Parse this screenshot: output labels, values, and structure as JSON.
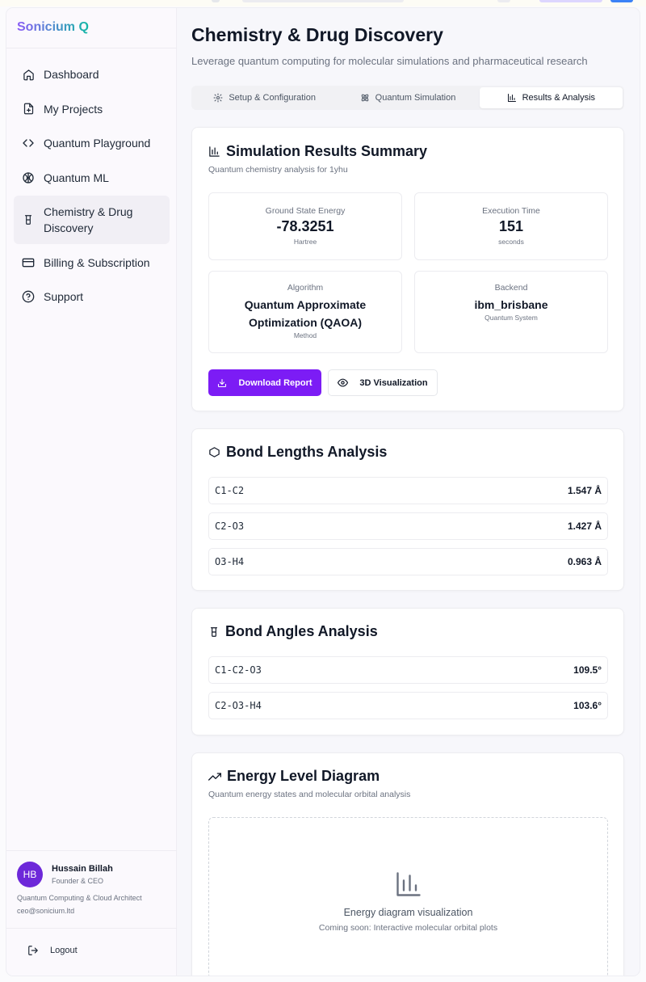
{
  "brand": "Sonicium Q",
  "sidebar": {
    "items": [
      {
        "label": "Dashboard",
        "icon": "home-icon"
      },
      {
        "label": "My Projects",
        "icon": "file-plus-icon"
      },
      {
        "label": "Quantum Playground",
        "icon": "code-icon"
      },
      {
        "label": "Quantum ML",
        "icon": "brain-icon"
      },
      {
        "label": "Chemistry & Drug Discovery",
        "icon": "beaker-icon",
        "active": true
      },
      {
        "label": "Billing & Subscription",
        "icon": "credit-card-icon"
      },
      {
        "label": "Support",
        "icon": "help-circle-icon"
      }
    ]
  },
  "profile": {
    "initials": "HB",
    "name": "Hussain Billah",
    "role": "Founder & CEO",
    "title": "Quantum Computing & Cloud Architect",
    "email": "ceo@sonicium.ltd"
  },
  "logout_label": "Logout",
  "page": {
    "title": "Chemistry & Drug Discovery",
    "subtitle": "Leverage quantum computing for molecular simulations and pharmaceutical research"
  },
  "tabs": [
    {
      "label": "Setup & Configuration",
      "icon": "settings-icon"
    },
    {
      "label": "Quantum Simulation",
      "icon": "atom-icon"
    },
    {
      "label": "Results & Analysis",
      "icon": "bar-chart-icon",
      "active": true
    }
  ],
  "summary": {
    "title": "Simulation Results Summary",
    "subtitle": "Quantum chemistry analysis for 1yhu",
    "energy": {
      "label": "Ground State Energy",
      "value": "-78.3251",
      "unit": "Hartree"
    },
    "time": {
      "label": "Execution Time",
      "value": "151",
      "unit": "seconds"
    },
    "algorithm": {
      "label": "Algorithm",
      "value": "Quantum Approximate Optimization (QAOA)",
      "unit": "Method"
    },
    "backend": {
      "label": "Backend",
      "value": "ibm_brisbane",
      "unit": "Quantum System"
    },
    "download_label": "Download Report",
    "visualize_label": "3D Visualization"
  },
  "bond_lengths": {
    "title": "Bond Lengths Analysis",
    "rows": [
      {
        "name": "C1-C2",
        "value": "1.547 Å"
      },
      {
        "name": "C2-O3",
        "value": "1.427 Å"
      },
      {
        "name": "O3-H4",
        "value": "0.963 Å"
      }
    ]
  },
  "bond_angles": {
    "title": "Bond Angles Analysis",
    "rows": [
      {
        "name": "C1-C2-O3",
        "value": "109.5°"
      },
      {
        "name": "C2-O3-H4",
        "value": "103.6°"
      }
    ]
  },
  "energy_diagram": {
    "title": "Energy Level Diagram",
    "subtitle": "Quantum energy states and molecular orbital analysis",
    "placeholder_title": "Energy diagram visualization",
    "placeholder_sub": "Coming soon: Interactive molecular orbital plots"
  },
  "colors": {
    "accent": "#7c1cf5",
    "avatar": "#6d28d9"
  }
}
